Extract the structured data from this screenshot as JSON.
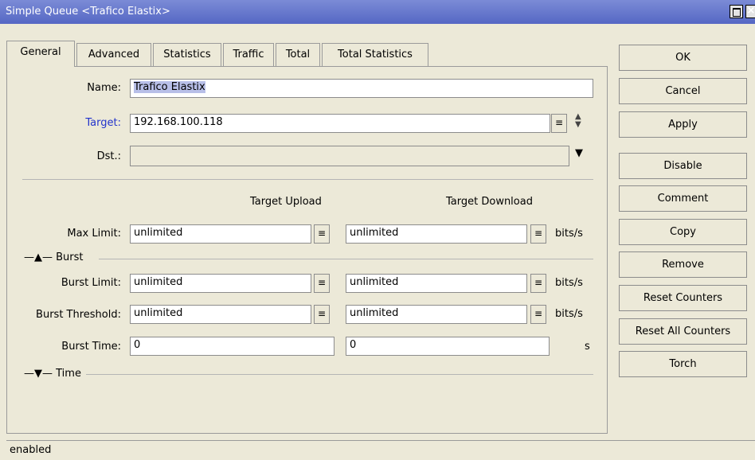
{
  "window": {
    "title": "Simple Queue <Trafico Elastix>",
    "status": "enabled"
  },
  "tabs": [
    "General",
    "Advanced",
    "Statistics",
    "Traffic",
    "Total",
    "Total Statistics"
  ],
  "general": {
    "name_label": "Name:",
    "name_value": "Trafico Elastix",
    "target_label": "Target:",
    "target_value": "192.168.100.118",
    "dst_label": "Dst.:",
    "dst_value": "",
    "col_upload": "Target Upload",
    "col_download": "Target Download",
    "max_limit_label": "Max Limit:",
    "max_limit_upload": "unlimited",
    "max_limit_download": "unlimited",
    "burst_section": "Burst",
    "burst_limit_label": "Burst Limit:",
    "burst_limit_upload": "unlimited",
    "burst_limit_download": "unlimited",
    "burst_threshold_label": "Burst Threshold:",
    "burst_threshold_upload": "unlimited",
    "burst_threshold_download": "unlimited",
    "burst_time_label": "Burst Time:",
    "burst_time_upload": "0",
    "burst_time_download": "0",
    "time_section": "Time",
    "unit_bits": "bits/s",
    "unit_s": "s"
  },
  "buttons": {
    "ok": "OK",
    "cancel": "Cancel",
    "apply": "Apply",
    "disable": "Disable",
    "comment": "Comment",
    "copy": "Copy",
    "remove": "Remove",
    "reset_counters": "Reset Counters",
    "reset_all_counters": "Reset All Counters",
    "torch": "Torch"
  },
  "colors": {
    "titlebar": "#6474cc",
    "target_label": "#2233cc",
    "selection": "#b8bfe8"
  }
}
